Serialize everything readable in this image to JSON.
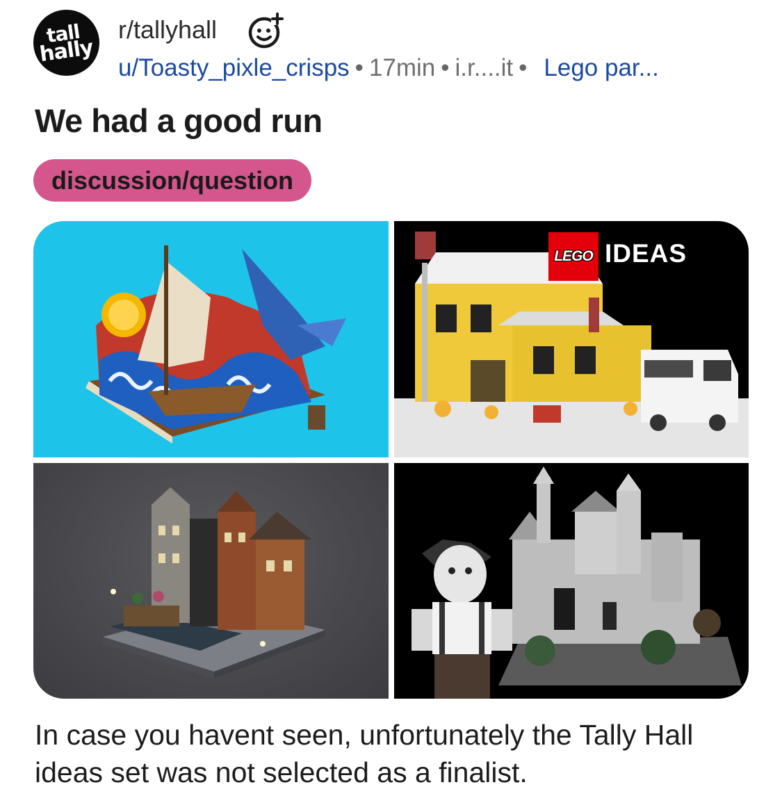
{
  "post": {
    "avatar_line1": "tall",
    "avatar_line2": "hally",
    "subreddit": "r/tallyhall",
    "author": "u/Toasty_pixle_crisps",
    "sep": "•",
    "age": "17min",
    "domain": "i.r....it",
    "link_title": "Lego par...",
    "title": "We had a good run",
    "flair": "discussion/question",
    "body": "In case you havent seen, unfortunately the Tally Hall ideas set was not selected as a finalist."
  },
  "gallery": {
    "badge_text": "LEGO",
    "ideas_text": "IDEAS"
  },
  "colors": {
    "flair_bg": "#d4568c",
    "link_blue": "#1a4aa0",
    "lego_red": "#e3000b",
    "tile1_bg": "#1ec3ea"
  }
}
